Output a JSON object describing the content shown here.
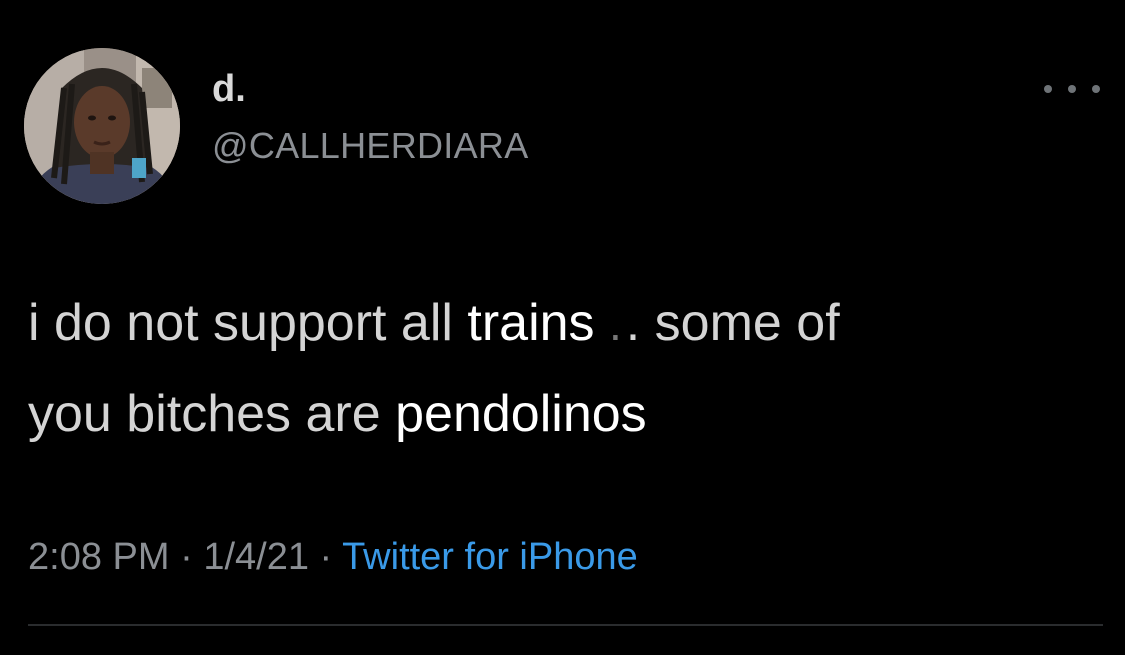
{
  "author": {
    "display_name": "d.",
    "handle": "@CALLHERDIARA"
  },
  "tweet": {
    "line1_start": "i do not support all",
    "line1_edit": "trains",
    "line1_mark": ".",
    "line1_end": ". some of",
    "line2_start": "you bitches are",
    "line2_edit": "pendolinos"
  },
  "meta": {
    "time": "2:08 PM",
    "separator": "·",
    "date": "1/4/21",
    "source": "Twitter for iPhone"
  },
  "colors": {
    "background": "#000000",
    "text": "#d4d4d4",
    "muted": "#8b8f94",
    "link": "#3a9ae8"
  },
  "icons": {
    "more": "more-horizontal-icon"
  }
}
